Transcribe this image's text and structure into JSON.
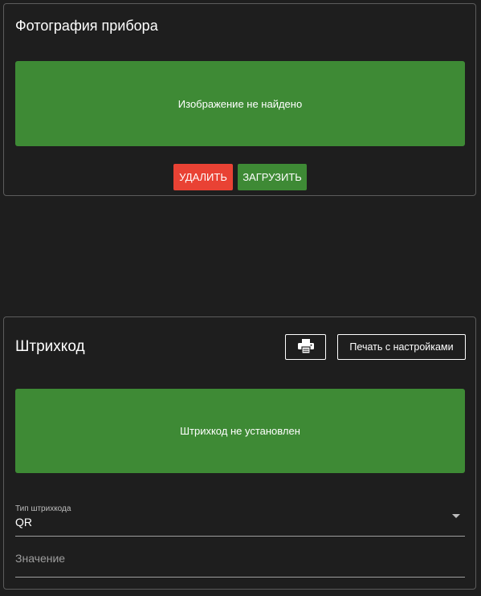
{
  "photo_section": {
    "title": "Фотография прибора",
    "placeholder_text": "Изображение не найдено",
    "delete_label": "УДАЛИТЬ",
    "upload_label": "ЗАГРУЗИТЬ"
  },
  "barcode_section": {
    "title": "Штрихкод",
    "print_icon": "printer-icon",
    "print_settings_label": "Печать с настройками",
    "placeholder_text": "Штрихкод не установлен",
    "type_field": {
      "label": "Тип штрихкода",
      "value": "QR"
    },
    "value_field": {
      "placeholder": "Значение",
      "value": ""
    }
  },
  "colors": {
    "background": "#1e1e1e",
    "panel_green": "#3e8a35",
    "delete_red": "#e94234",
    "border": "#5c5c5c"
  }
}
